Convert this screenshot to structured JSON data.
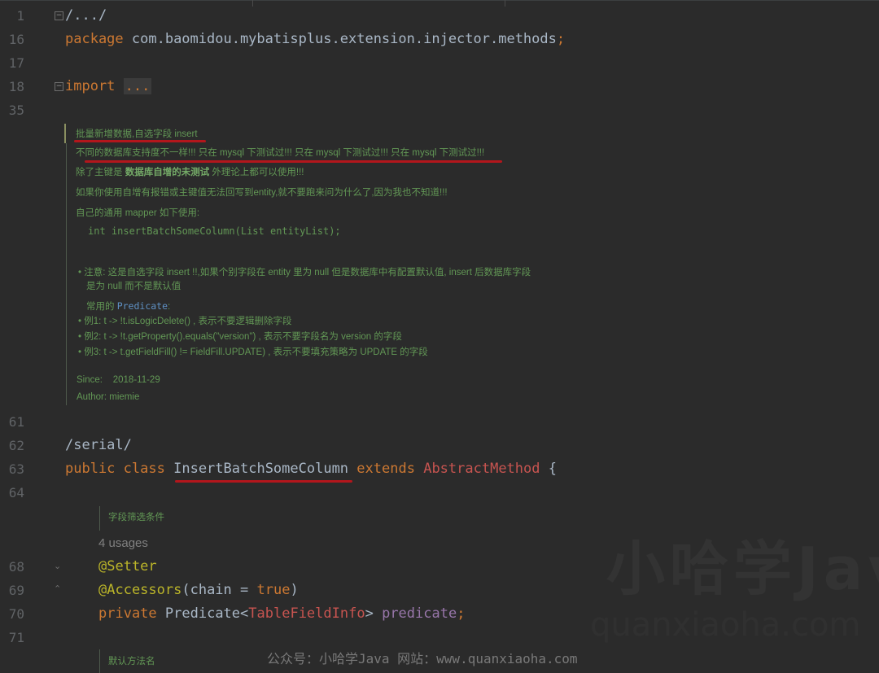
{
  "editor": {
    "line_numbers": [
      "1",
      "16",
      "17",
      "18",
      "35",
      "61",
      "62",
      "63",
      "64",
      "68",
      "69",
      "70",
      "71"
    ],
    "lines": {
      "path_comment": "/.../",
      "package_kw": "package",
      "package_name": " com.baomidou.mybatisplus.extension.injector.methods",
      "package_semi": ";",
      "import_kw": "import",
      "import_folded": "...",
      "serial_comment": "/serial/",
      "public_kw": "public",
      "class_kw": "class",
      "class_name": "InsertBatchSomeColumn",
      "extends_kw": "extends",
      "super_class": "AbstractMethod",
      "open_brace": " {",
      "annot_setter": "@Setter",
      "annot_accessors": "@Accessors",
      "accessors_args_open": "(chain = ",
      "accessors_true": "true",
      "accessors_args_close": ")",
      "private_kw": "private",
      "field_type": "Predicate",
      "generic_open": "<",
      "generic_type": "TableFieldInfo",
      "generic_close": ">",
      "field_name": "predicate",
      "field_semi": ";"
    },
    "javadoc": {
      "line1": "批量新增数据,自选字段 insert",
      "line2": "不同的数据库支持度不一样!!! 只在 mysql 下测试过!!! 只在 mysql 下测试过!!! 只在 mysql 下测试过!!!",
      "line3_pre": "除了主键是 ",
      "line3_bold": "数据库自增的未测试",
      "line3_post": " 外理论上都可以使用!!!",
      "line4": "如果你使用自增有报错或主键值无法回写到entity,就不要跑来问为什么了,因为我也不知道!!!",
      "line5": "自己的通用 mapper 如下使用:",
      "code_sample": "int insertBatchSomeColumn(List entityList);",
      "bullet": "•",
      "note_line1": "注意: 这是自选字段 insert !!,如果个别字段在 entity 里为 null 但是数据库中有配置默认值, insert 后数据库字段",
      "note_line2": "是为 null 而不是默认值",
      "common_pre": "常用的 ",
      "common_link": "Predicate",
      "common_post": ":",
      "ex1": "例1: t -> !t.isLogicDelete() , 表示不要逻辑删除字段",
      "ex2": "例2: t -> !t.getProperty().equals(\"version\") , 表示不要字段名为 version 的字段",
      "ex3": "例3: t -> t.getFieldFill() != FieldFill.UPDATE) , 表示不要填充策略为 UPDATE 的字段",
      "since_label": "Since:",
      "since_value": "2018-11-29",
      "author_label": "Author:",
      "author_value": "miemie"
    },
    "field_doc": "字段筛选条件",
    "usages": "4 usages",
    "method_doc": "默认方法名"
  },
  "watermark": {
    "big": "小哈学Java",
    "small": "quanxiaoha.com",
    "footer": "公众号：小哈学Java 网站：www.quanxiaoha.com"
  },
  "colors": {
    "background": "#2b2b2b",
    "keyword": "#cc7832",
    "text": "#a9b7c6",
    "annotation": "#bbb529",
    "field": "#9876aa",
    "doc": "#629755",
    "underline": "#b3161c"
  }
}
